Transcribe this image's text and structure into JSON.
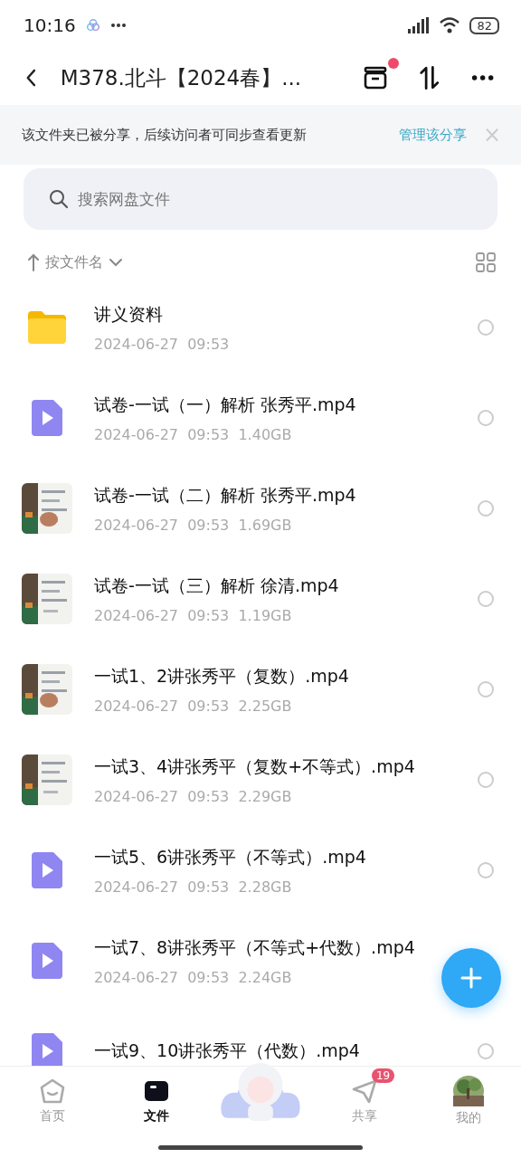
{
  "status_bar": {
    "time": "10:16",
    "battery": "82"
  },
  "header": {
    "title": "M378.北斗【2024春】...",
    "badge_dot": true
  },
  "share_banner": {
    "text": "该文件夹已被分享，后续访问者可同步查看更新",
    "action": "管理该分享",
    "close": "×"
  },
  "search": {
    "placeholder": "搜索网盘文件"
  },
  "sort": {
    "label": "按文件名"
  },
  "files": [
    {
      "kind": "folder",
      "name": "讲义资料",
      "meta": "2024-06-27  09:53",
      "selected": false
    },
    {
      "kind": "video",
      "name": "试卷-一试（一）解析 张秀平.mp4",
      "meta": "2024-06-27  09:53  1.40GB",
      "selected": false
    },
    {
      "kind": "picture",
      "name": "试卷-一试（二）解析 张秀平.mp4",
      "meta": "2024-06-27  09:53  1.69GB",
      "selected": false
    },
    {
      "kind": "picture",
      "name": "试卷-一试（三）解析 徐清.mp4",
      "meta": "2024-06-27  09:53  1.19GB",
      "selected": false
    },
    {
      "kind": "picture",
      "name": "一试1、2讲张秀平（复数）.mp4",
      "meta": "2024-06-27  09:53  2.25GB",
      "selected": false
    },
    {
      "kind": "picture",
      "name": "一试3、4讲张秀平（复数+不等式）.mp4",
      "meta": "2024-06-27  09:53  2.29GB",
      "selected": false
    },
    {
      "kind": "video",
      "name": "一试5、6讲张秀平（不等式）.mp4",
      "meta": "2024-06-27  09:53  2.28GB",
      "selected": false
    },
    {
      "kind": "video",
      "name": "一试7、8讲张秀平（不等式+代数）.mp4",
      "meta": "2024-06-27  09:53  2.24GB"
    },
    {
      "kind": "video",
      "name": "一试9、10讲张秀平（代数）.mp4",
      "selected": false
    }
  ],
  "nav": [
    {
      "kind": "home",
      "label": "首页",
      "selected": false
    },
    {
      "kind": "files",
      "label": "文件",
      "selected": true
    },
    {
      "kind": "center"
    },
    {
      "kind": "share",
      "label": "共享",
      "selected": false,
      "badge": "19"
    },
    {
      "kind": "me",
      "label": "我的",
      "selected": false
    }
  ]
}
